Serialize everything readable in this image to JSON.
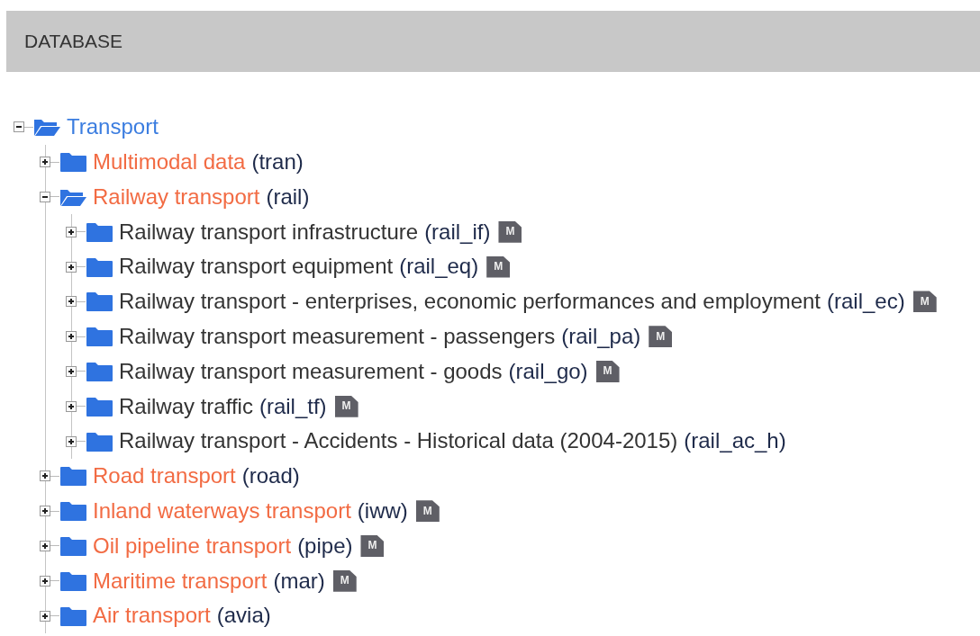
{
  "header": {
    "title": "DATABASE"
  },
  "tree": [
    {
      "label": "Transport",
      "expanded": true,
      "children": [
        {
          "label": "Multimodal data",
          "code": "(tran)",
          "expanded": false
        },
        {
          "label": "Railway transport",
          "code": "(rail)",
          "expanded": true,
          "children": [
            {
              "label": "Railway transport infrastructure",
              "code": "(rail_if)",
              "expanded": false,
              "badge": "M"
            },
            {
              "label": "Railway transport equipment",
              "code": "(rail_eq)",
              "expanded": false,
              "badge": "M"
            },
            {
              "label": "Railway transport - enterprises, economic performances and employment",
              "code": "(rail_ec)",
              "expanded": false,
              "badge": "M"
            },
            {
              "label": "Railway transport measurement - passengers",
              "code": "(rail_pa)",
              "expanded": false,
              "badge": "M"
            },
            {
              "label": "Railway transport measurement - goods",
              "code": "(rail_go)",
              "expanded": false,
              "badge": "M"
            },
            {
              "label": "Railway traffic",
              "code": "(rail_tf)",
              "expanded": false,
              "badge": "M"
            },
            {
              "label": "Railway transport - Accidents - Historical data (2004-2015)",
              "code": "(rail_ac_h)",
              "expanded": false
            }
          ]
        },
        {
          "label": "Road transport",
          "code": "(road)",
          "expanded": false
        },
        {
          "label": "Inland waterways transport",
          "code": "(iww)",
          "expanded": false,
          "badge": "M"
        },
        {
          "label": "Oil pipeline transport",
          "code": "(pipe)",
          "expanded": false,
          "badge": "M"
        },
        {
          "label": "Maritime transport",
          "code": "(mar)",
          "expanded": false,
          "badge": "M"
        },
        {
          "label": "Air transport",
          "code": "(avia)",
          "expanded": false
        }
      ]
    }
  ]
}
